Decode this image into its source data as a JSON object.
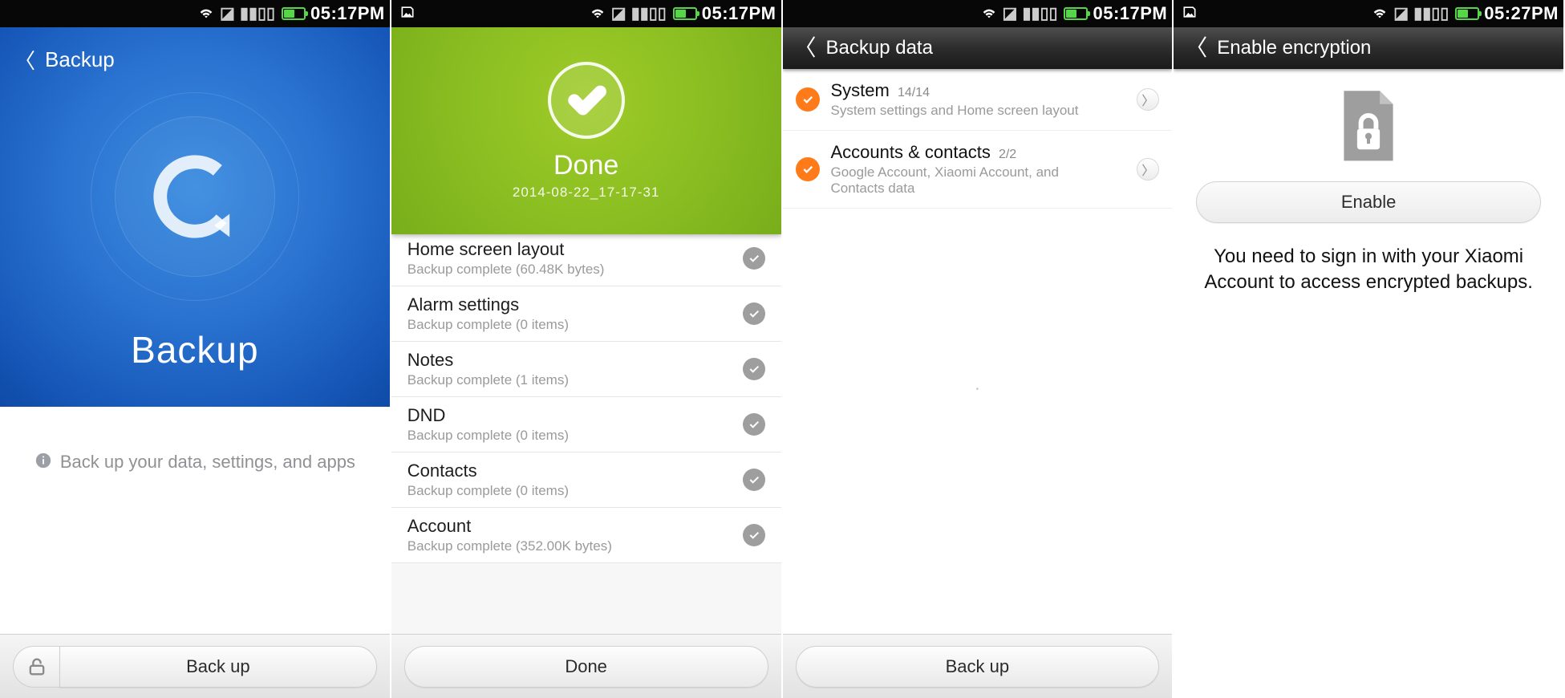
{
  "status": {
    "time_a": "05:17PM",
    "time_b": "05:27PM"
  },
  "screen1": {
    "nav_title": "Backup",
    "hero_label": "Backup",
    "info_text": "Back up your data, settings, and apps",
    "button": "Back up"
  },
  "screen2": {
    "done_title": "Done",
    "done_timestamp": "2014-08-22_17-17-31",
    "items": [
      {
        "title": "Home screen layout",
        "sub": "Backup complete (60.48K  bytes)"
      },
      {
        "title": "Alarm settings",
        "sub": "Backup complete (0  items)"
      },
      {
        "title": "Notes",
        "sub": "Backup complete (1  items)"
      },
      {
        "title": "DND",
        "sub": "Backup complete (0  items)"
      },
      {
        "title": "Contacts",
        "sub": "Backup complete (0  items)"
      },
      {
        "title": "Account",
        "sub": "Backup complete (352.00K  bytes)"
      }
    ],
    "button": "Done"
  },
  "screen3": {
    "nav_title": "Backup data",
    "categories": [
      {
        "title": "System",
        "count": "14/14",
        "sub": "System settings and Home screen layout"
      },
      {
        "title": "Accounts & contacts",
        "count": "2/2",
        "sub": "Google Account, Xiaomi Account, and Contacts data"
      }
    ],
    "button": "Back up"
  },
  "screen4": {
    "nav_title": "Enable encryption",
    "enable_label": "Enable",
    "message": "You need to sign in with your Xiaomi Account to access encrypted backups."
  }
}
